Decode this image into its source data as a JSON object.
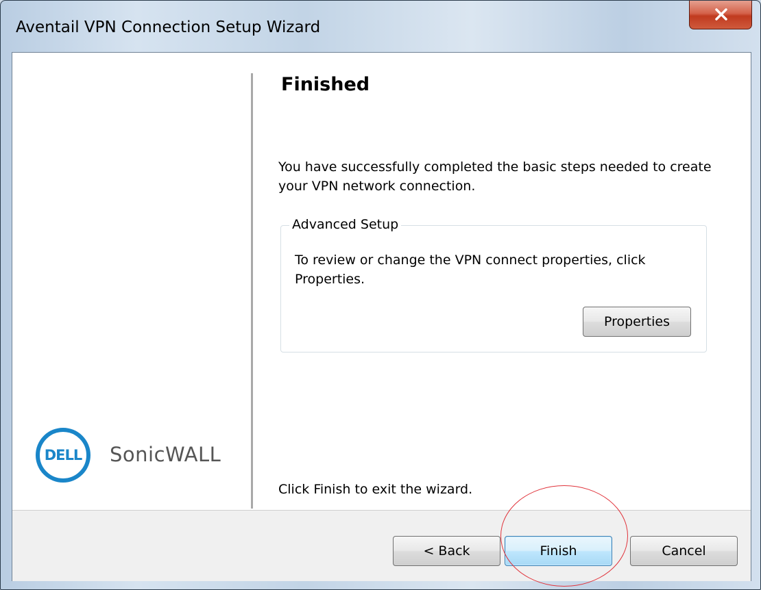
{
  "window": {
    "title": "Aventail VPN Connection Setup Wizard"
  },
  "page": {
    "heading": "Finished",
    "intro": "You have successfully completed the basic steps needed to create your VPN network connection.",
    "advanced_setup": {
      "legend": "Advanced Setup",
      "text": "To review or change the VPN connect properties, click Properties.",
      "properties_label": "Properties"
    },
    "exit_hint": "Click Finish to exit the wizard."
  },
  "branding": {
    "dell_logo_text": "DELL",
    "product_name": "SonicWALL",
    "accent_color": "#1a86c9"
  },
  "footer": {
    "back_label": "< Back",
    "finish_label": "Finish",
    "cancel_label": "Cancel"
  },
  "colors": {
    "annotation": "#e0323a",
    "close_button": "#c8432a"
  }
}
